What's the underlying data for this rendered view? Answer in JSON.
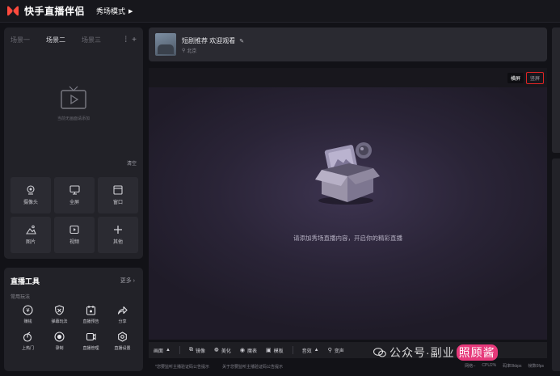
{
  "app": {
    "title": "快手直播伴侣",
    "mode_label": "秀场模式"
  },
  "scenes": {
    "tabs": [
      "场景一",
      "场景二",
      "场景三"
    ],
    "active_index": 1,
    "empty_text": "当前无画面请添加",
    "clear_label": "清空"
  },
  "sources": [
    {
      "label": "摄像头",
      "icon": "camera-icon"
    },
    {
      "label": "全屏",
      "icon": "monitor-icon"
    },
    {
      "label": "窗口",
      "icon": "window-icon"
    },
    {
      "label": "图片",
      "icon": "image-icon"
    },
    {
      "label": "视频",
      "icon": "video-icon"
    },
    {
      "label": "其他",
      "icon": "plus-icon"
    }
  ],
  "tools": {
    "title": "直播工具",
    "more_label": "更多",
    "section_label": "常用玩法",
    "items": [
      {
        "label": "赚钱",
        "icon": "coin-icon"
      },
      {
        "label": "弹幕玩法",
        "icon": "shield-icon"
      },
      {
        "label": "直播预告",
        "icon": "calendar-icon"
      },
      {
        "label": "分享",
        "icon": "share-icon"
      },
      {
        "label": "上热门",
        "icon": "fire-icon"
      },
      {
        "label": "录制",
        "icon": "record-icon"
      },
      {
        "label": "直播管理",
        "icon": "manage-icon"
      },
      {
        "label": "直播设置",
        "icon": "settings-icon"
      }
    ]
  },
  "stream": {
    "title": "短剧推荐 欢迎观看",
    "location": "北京"
  },
  "preview": {
    "horizontal_label": "横屏",
    "vertical_label": "竖屏",
    "empty_message": "请添加秀场直播内容，开启你的精彩直播"
  },
  "bottom_toolbar": [
    {
      "label": "画面",
      "icon": "picture-icon",
      "has_caret": true
    },
    {
      "label": "镜像",
      "icon": "mirror-icon",
      "has_caret": false
    },
    {
      "label": "美化",
      "icon": "beauty-icon",
      "has_caret": false
    },
    {
      "label": "魔表",
      "icon": "magic-icon",
      "has_caret": false
    },
    {
      "label": "模板",
      "icon": "template-icon",
      "has_caret": false
    },
    {
      "label": "音效",
      "icon": "sound-icon",
      "has_caret": true
    },
    {
      "label": "变声",
      "icon": "voice-icon",
      "has_caret": false
    }
  ],
  "status": {
    "notice1": "*您要监听主播验证码公告提示",
    "notice2": "关于您要监听主播验证码公告提示",
    "stats": [
      "网络--",
      "CPU2%",
      "码率0kbps",
      "帧数0fps"
    ]
  },
  "watermark": {
    "prefix": "公众号·副业",
    "highlight": "照顾酱"
  },
  "colors": {
    "accent_red": "#e02424",
    "watermark_pink": "#e6397a"
  }
}
